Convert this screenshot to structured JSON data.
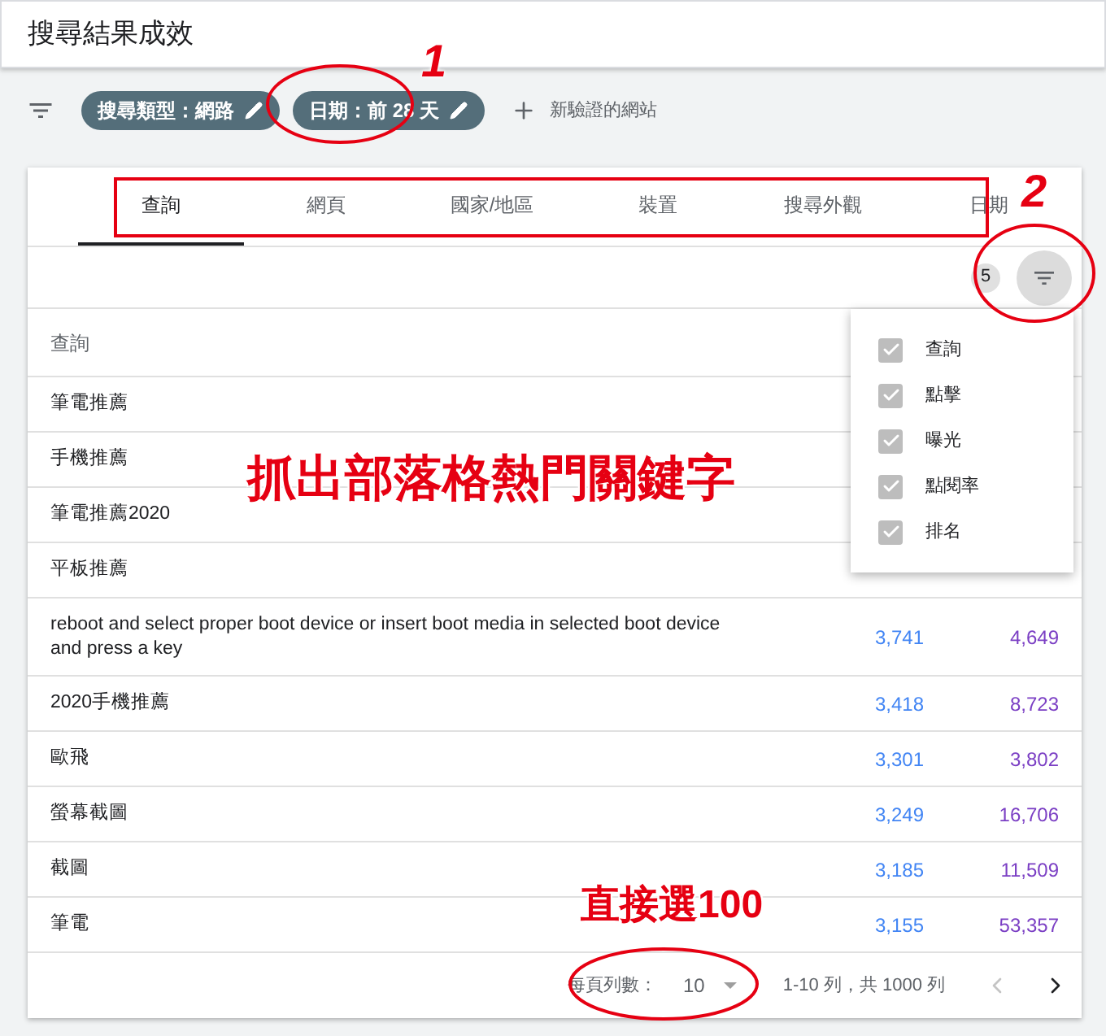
{
  "header": {
    "title": "搜尋結果成效"
  },
  "filters": {
    "chips": [
      {
        "label": "搜尋類型：網路"
      },
      {
        "label": "日期：前 28 天"
      }
    ],
    "add_label": "新驗證的網站"
  },
  "tabs": [
    {
      "label": "查詢",
      "selected": true
    },
    {
      "label": "網頁",
      "selected": false
    },
    {
      "label": "國家/地區",
      "selected": false
    },
    {
      "label": "裝置",
      "selected": false
    },
    {
      "label": "搜尋外觀",
      "selected": false
    },
    {
      "label": "日期",
      "selected": false
    }
  ],
  "column_count": "5",
  "table": {
    "header": "查詢",
    "rows": [
      {
        "query": "筆電推薦"
      },
      {
        "query": "手機推薦"
      },
      {
        "query": "筆電推薦2020"
      },
      {
        "query": "平板推薦"
      },
      {
        "query": "reboot and select proper boot device or insert boot media in selected boot device and press a key",
        "clicks": "3,741",
        "impressions": "4,649"
      },
      {
        "query": "2020手機推薦",
        "clicks": "3,418",
        "impressions": "8,723"
      },
      {
        "query": "歐飛",
        "clicks": "3,301",
        "impressions": "3,802"
      },
      {
        "query": "螢幕截圖",
        "clicks": "3,249",
        "impressions": "16,706"
      },
      {
        "query": "截圖",
        "clicks": "3,185",
        "impressions": "11,509"
      },
      {
        "query": "筆電",
        "clicks": "3,155",
        "impressions": "53,357"
      }
    ]
  },
  "column_menu": [
    {
      "label": "查詢",
      "checked": true
    },
    {
      "label": "點擊",
      "checked": true
    },
    {
      "label": "曝光",
      "checked": true
    },
    {
      "label": "點閱率",
      "checked": true
    },
    {
      "label": "排名",
      "checked": true
    }
  ],
  "pagination": {
    "rows_per_page_label": "每頁列數：",
    "rows_per_page": "10",
    "range": "1-10 列，共 1000 列",
    "previous": {
      "disabled": true
    },
    "next": {
      "disabled": false
    }
  },
  "annotations": [
    {
      "kind": "ellipse"
    },
    {
      "kind": "number",
      "text": "1"
    },
    {
      "kind": "rectangle"
    },
    {
      "kind": "number",
      "text": "2"
    },
    {
      "kind": "ellipse"
    },
    {
      "kind": "caption",
      "text": "抓出部落格熱門關鍵字"
    },
    {
      "kind": "caption",
      "text": "直接選100"
    },
    {
      "kind": "ellipse"
    }
  ]
}
